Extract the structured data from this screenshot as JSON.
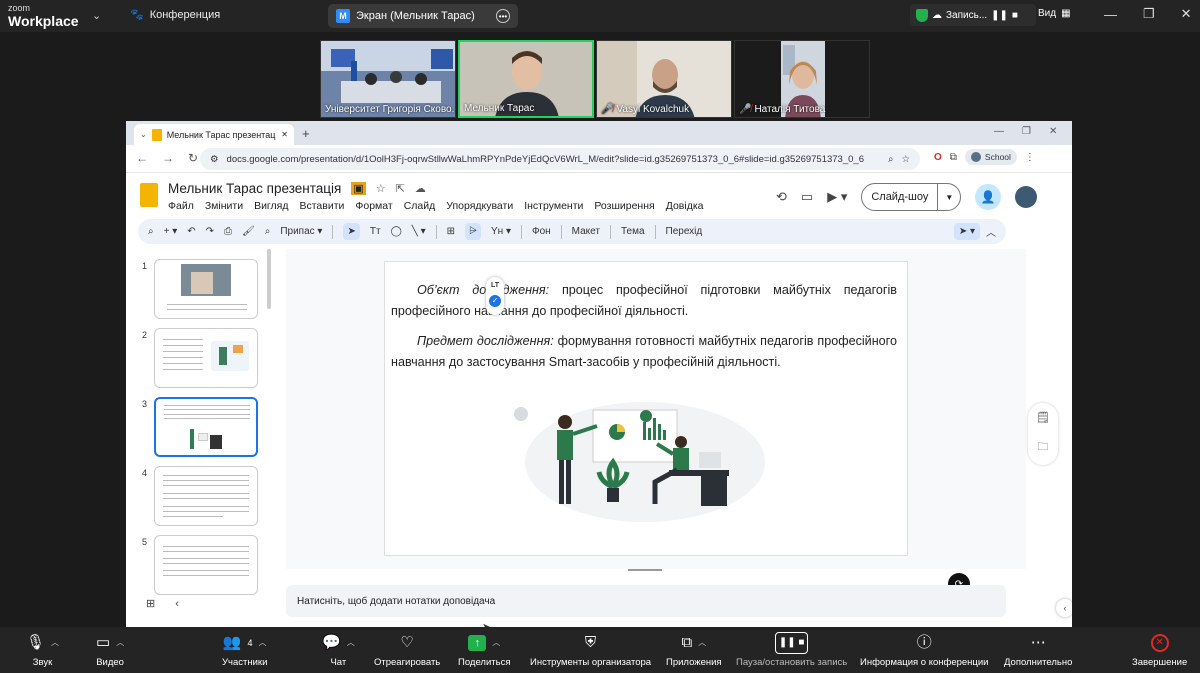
{
  "zoom": {
    "logo_small": "zoom",
    "logo_big": "Workplace",
    "meeting_label": "Конференция",
    "share_title": "Экран (Мельник Тарас)",
    "share_badge": "M",
    "recording_label": "Запись...",
    "view_label": "Вид",
    "participants": [
      {
        "name": "Університет Григорія Сково...",
        "muted": false,
        "active": false
      },
      {
        "name": "Мельник Тарас",
        "muted": false,
        "active": true
      },
      {
        "name": "Vasyl Kovalchuk",
        "muted": true,
        "active": false
      },
      {
        "name": "Наталія Титова",
        "muted": true,
        "active": false
      }
    ],
    "bottom": {
      "audio": "Звук",
      "video": "Видео",
      "participants": "Участники",
      "participants_count": "4",
      "chat": "Чат",
      "react": "Отреагировать",
      "share": "Поделиться",
      "host_tools": "Инструменты организатора",
      "apps": "Приложения",
      "pause_record": "Пауза/остановить запись",
      "info": "Информация о конференции",
      "more": "Дополнительно",
      "end": "Завершение"
    }
  },
  "browser": {
    "tab_title": "Мельник Тарас презентація -",
    "url": "docs.google.com/presentation/d/1OolH3Fj-oqrwStllwWaLhmRPYnPdeYjEdQcV6WrL_M/edit?slide=id.g35269751373_0_6#slide=id.g35269751373_0_6",
    "profile_label": "School"
  },
  "slides": {
    "doc_title": "Мельник Тарас презентація",
    "menus": [
      "Файл",
      "Змінити",
      "Вигляд",
      "Вставити",
      "Формат",
      "Слайд",
      "Упорядкувати",
      "Інструменти",
      "Розширення",
      "Довідка"
    ],
    "slideshow_label": "Слайд-шоу",
    "toolbar": {
      "zoom_label": "Припас",
      "bg": "Фон",
      "layout": "Макет",
      "theme": "Тема",
      "transition": "Перехід"
    },
    "thumbnails": [
      "1",
      "2",
      "3",
      "4",
      "5"
    ],
    "current_slide": 3,
    "slide": {
      "p1_label": "Об’єкт дослідження:",
      "p1_text": " процес професійної підготовки майбутніх педагогів професійного навчання до професійної діяльності.",
      "p2_label": "Предмет дослідження:",
      "p2_text": " формування готовності майбутніх педагогів професійного навчання до застосування Smart-засобів у професійній діяльності."
    },
    "lt_badge": "LT",
    "notes_placeholder": "Натисніть, щоб додати нотатки доповідача"
  }
}
